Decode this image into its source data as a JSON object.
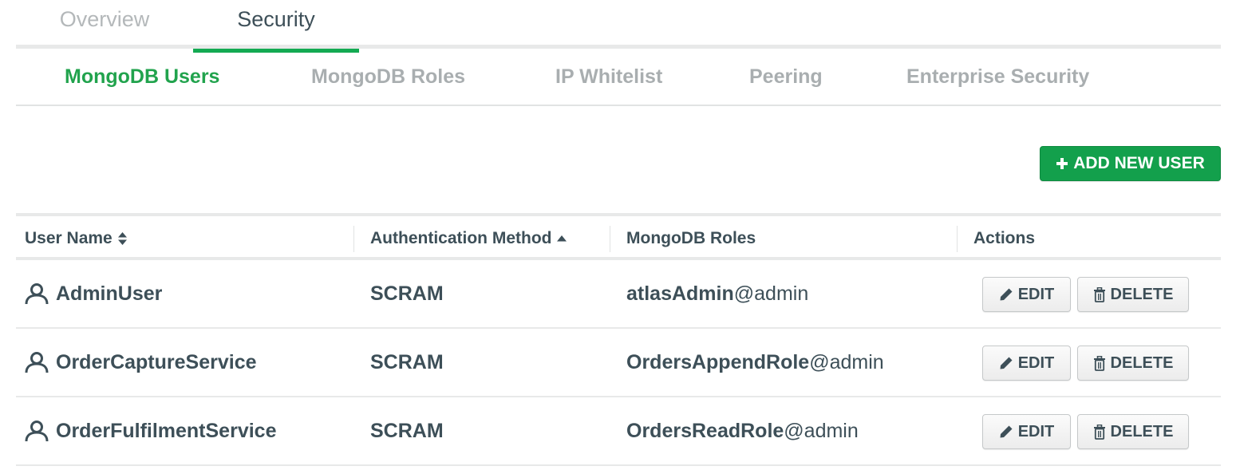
{
  "top_tabs": [
    {
      "label": "Overview",
      "active": false
    },
    {
      "label": "Security",
      "active": true
    }
  ],
  "sub_tabs": [
    {
      "label": "MongoDB Users",
      "active": true
    },
    {
      "label": "MongoDB Roles",
      "active": false
    },
    {
      "label": "IP Whitelist",
      "active": false
    },
    {
      "label": "Peering",
      "active": false
    },
    {
      "label": "Enterprise Security",
      "active": false
    }
  ],
  "add_user_button": {
    "label": "ADD NEW USER",
    "icon": "plus-icon"
  },
  "table": {
    "columns": [
      {
        "label": "User Name",
        "sort": "sortable"
      },
      {
        "label": "Authentication Method",
        "sort": "ascending"
      },
      {
        "label": "MongoDB Roles",
        "sort": "none"
      },
      {
        "label": "Actions",
        "sort": "none"
      }
    ],
    "rows": [
      {
        "user": "AdminUser",
        "auth": "SCRAM",
        "role": "atlasAdmin",
        "role_db": "@admin"
      },
      {
        "user": "OrderCaptureService",
        "auth": "SCRAM",
        "role": "OrdersAppendRole",
        "role_db": "@admin"
      },
      {
        "user": "OrderFulfilmentService",
        "auth": "SCRAM",
        "role": "OrdersReadRole",
        "role_db": "@admin"
      }
    ],
    "actions": {
      "edit_label": "EDIT",
      "delete_label": "DELETE"
    }
  },
  "colors": {
    "accent": "#13aa52",
    "button_green": "#13a04c",
    "text": "#3d4f58",
    "muted": "#a9aeb0"
  }
}
